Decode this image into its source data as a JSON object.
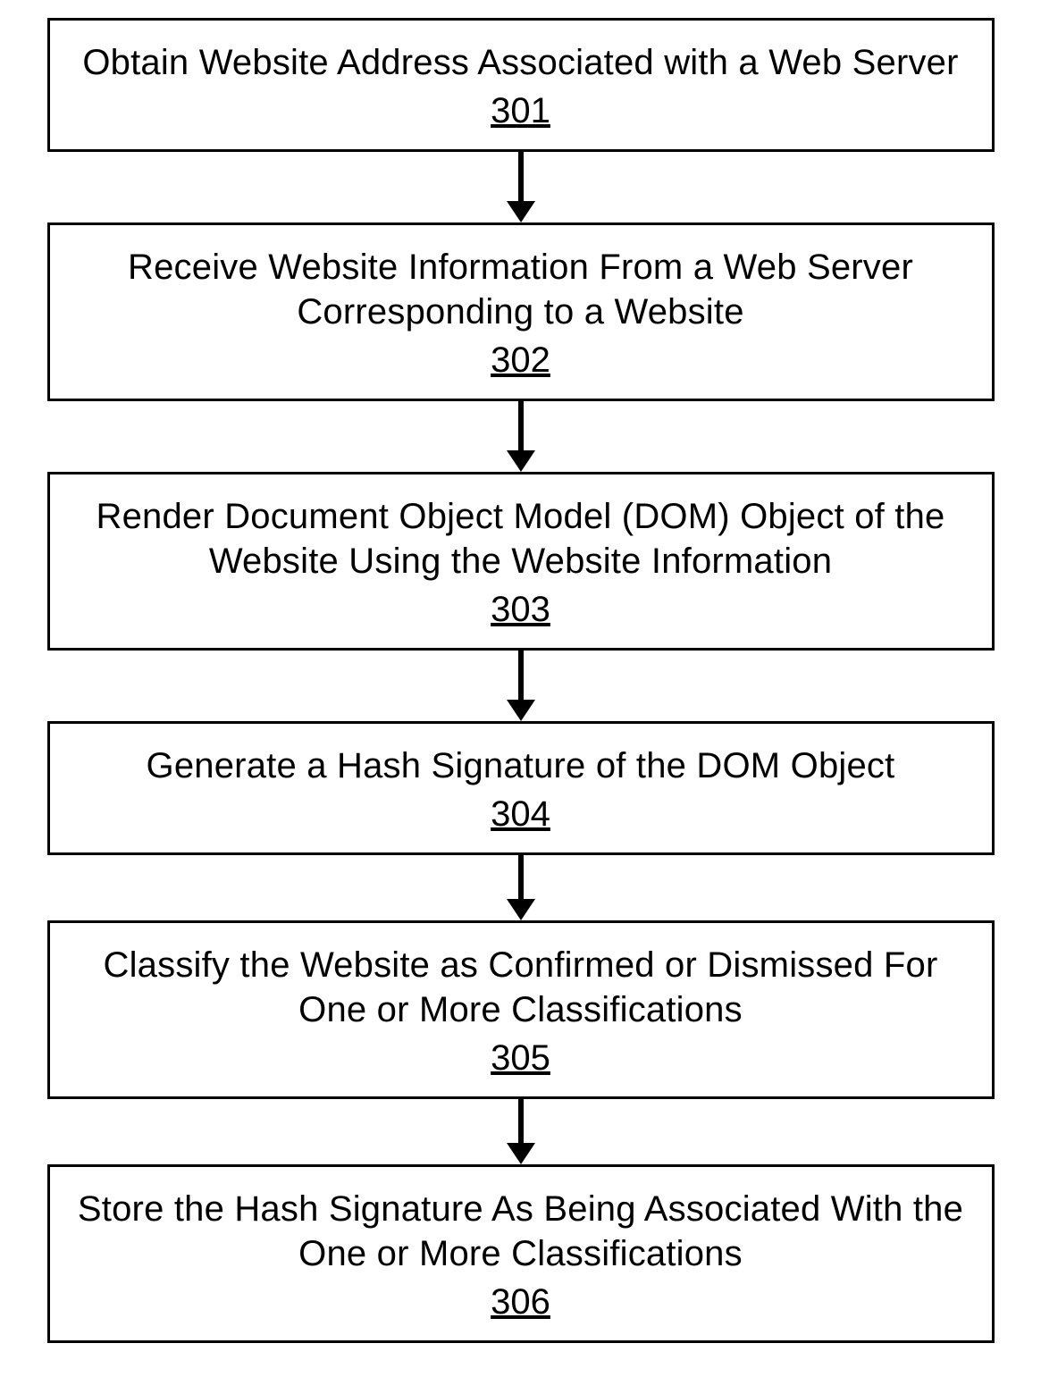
{
  "chart_data": {
    "type": "flowchart",
    "direction": "top-to-bottom",
    "nodes": [
      {
        "id": "301",
        "label": "Obtain Website Address Associated with a Web Server"
      },
      {
        "id": "302",
        "label": "Receive Website Information From a Web Server Corresponding to a Website"
      },
      {
        "id": "303",
        "label": "Render Document Object Model (DOM) Object of the Website Using the Website Information"
      },
      {
        "id": "304",
        "label": "Generate a Hash Signature of the DOM Object"
      },
      {
        "id": "305",
        "label": "Classify the Website as Confirmed or Dismissed For One or More Classifications"
      },
      {
        "id": "306",
        "label": "Store the Hash Signature As Being Associated With the One or More Classifications"
      }
    ],
    "edges": [
      {
        "from": "301",
        "to": "302"
      },
      {
        "from": "302",
        "to": "303"
      },
      {
        "from": "303",
        "to": "304"
      },
      {
        "from": "304",
        "to": "305"
      },
      {
        "from": "305",
        "to": "306"
      }
    ]
  }
}
